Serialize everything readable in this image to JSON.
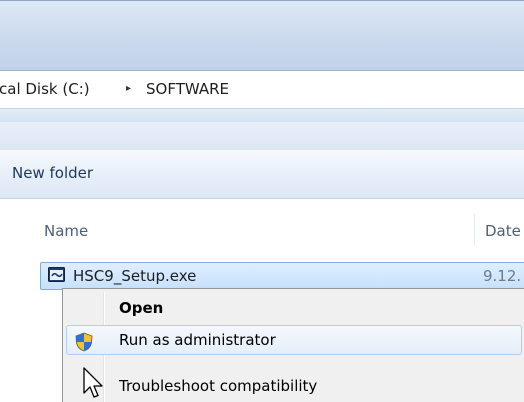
{
  "address": {
    "crumbs": [
      "cal Disk (C:)",
      "SOFTWARE"
    ],
    "separator": "▸"
  },
  "toolbar": {
    "new_folder_label": "New folder"
  },
  "columns": {
    "name": "Name",
    "date": "Date"
  },
  "file": {
    "name": "HSC9_Setup.exe",
    "date": "9.12.",
    "icon": "installer-icon"
  },
  "context_menu": {
    "items": [
      {
        "label": "Open",
        "bold": true
      },
      {
        "label": "Run as administrator",
        "icon": "uac-shield-icon"
      },
      {
        "label": "Troubleshoot compatibility"
      }
    ]
  },
  "colors": {
    "selection_border": "#84acdd",
    "selection_fill": "#cce4fc",
    "menu_background": "#f0f0f0",
    "toolbar_text": "#1e395b"
  }
}
